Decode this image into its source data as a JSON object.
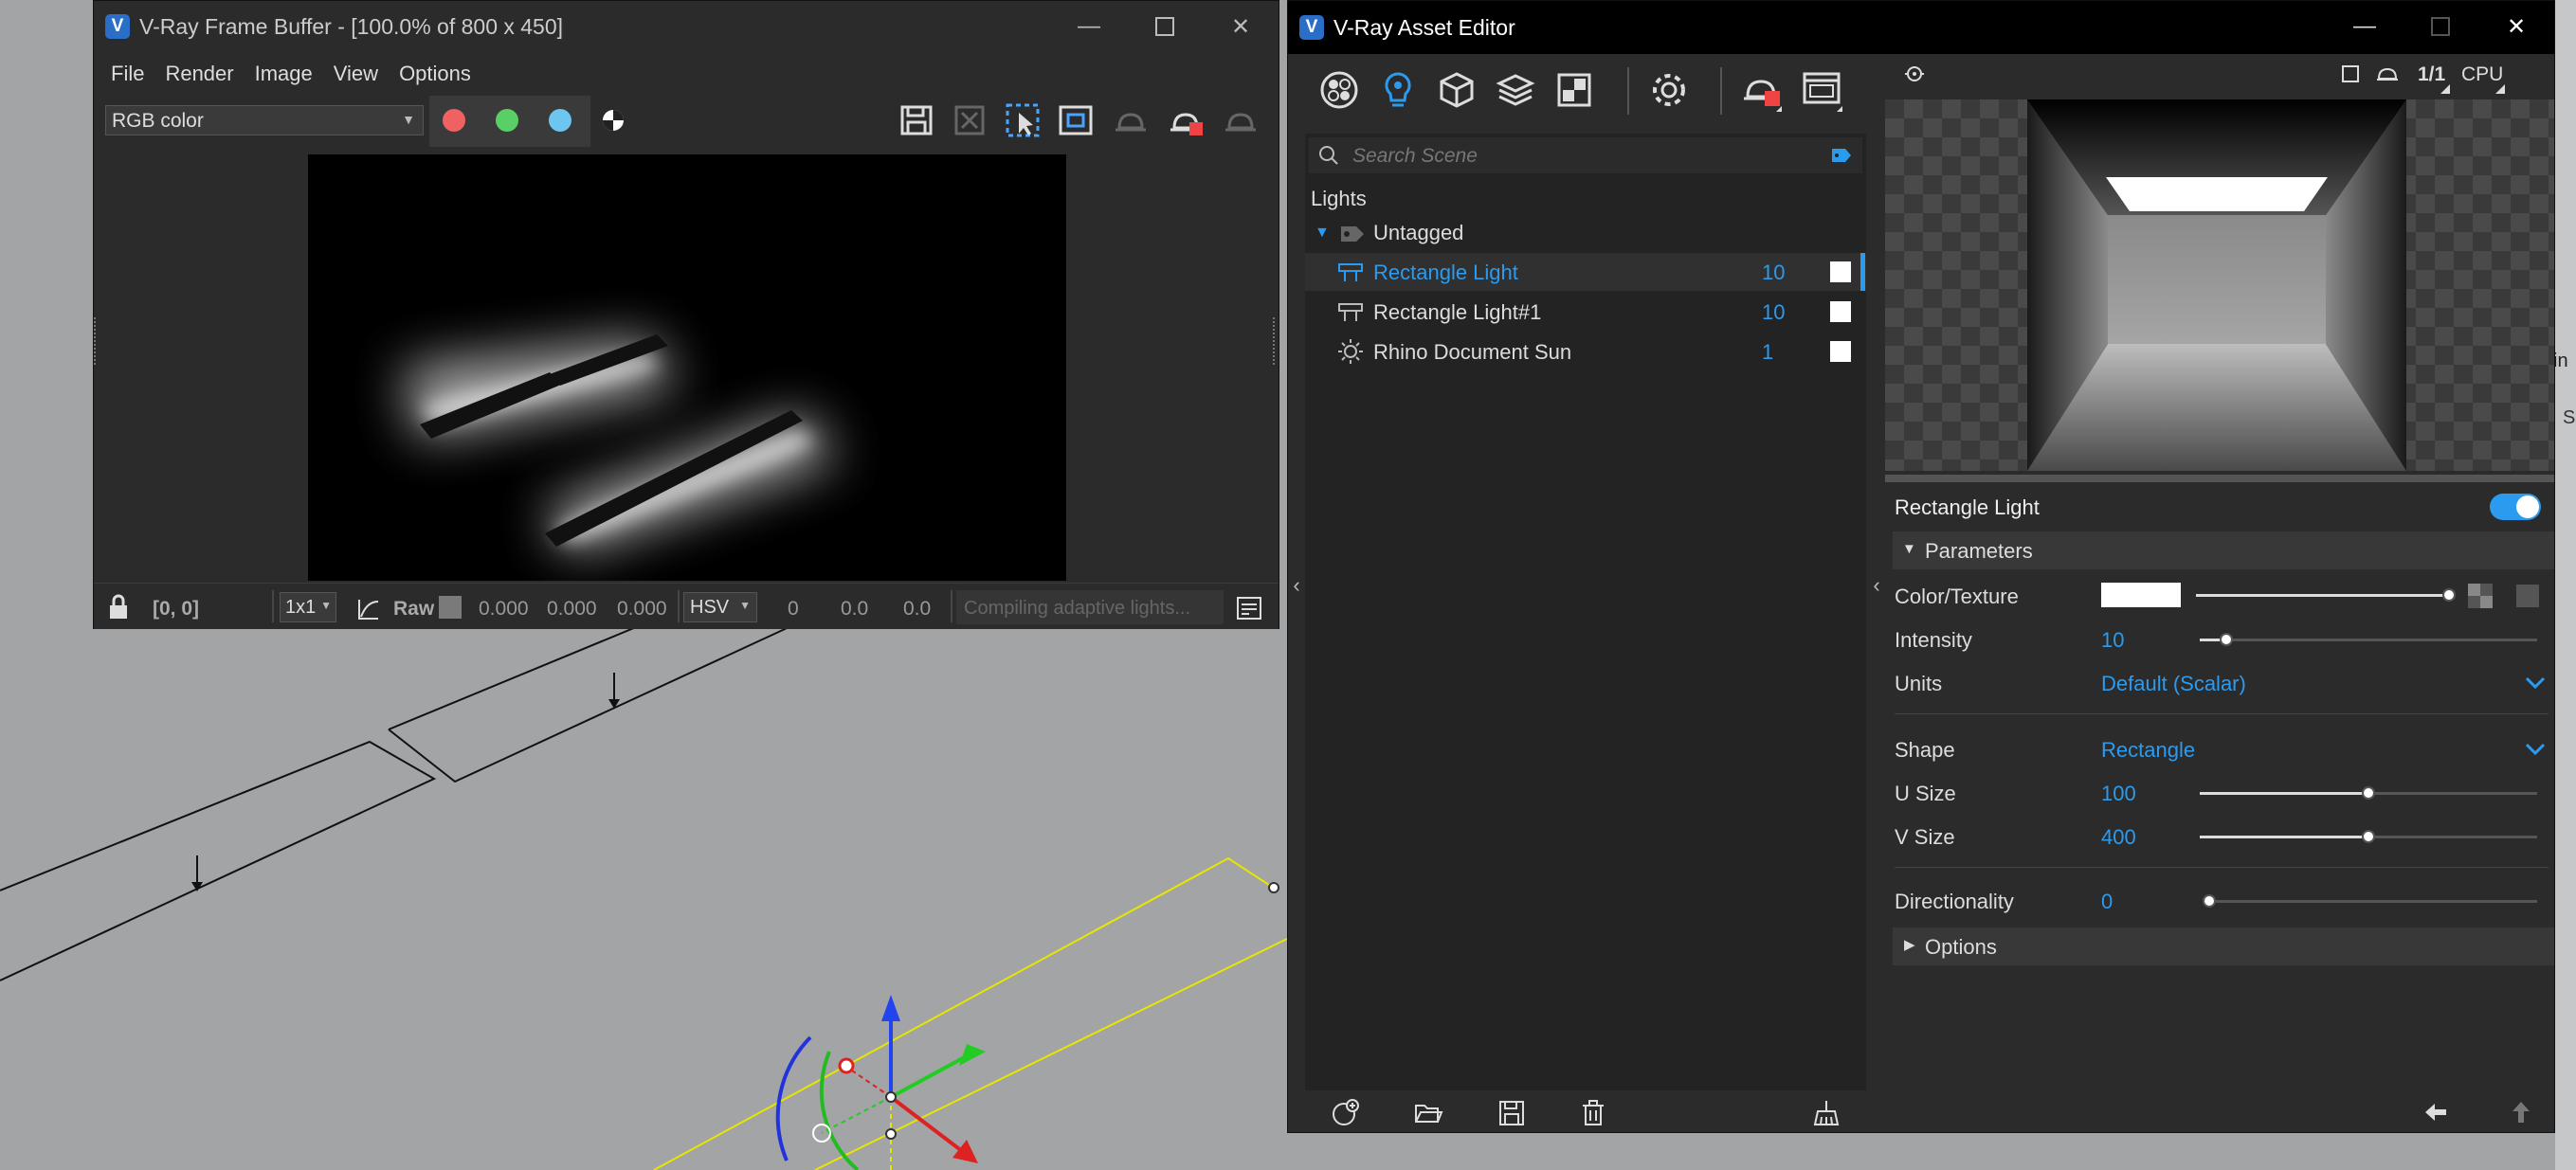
{
  "frame_buffer": {
    "title": "V-Ray Frame Buffer - [100.0% of 800 x 450]",
    "menu": [
      "File",
      "Render",
      "Image",
      "View",
      "Options"
    ],
    "channel_select": "RGB color",
    "status": {
      "coords": "[0, 0]",
      "sample": "1x1",
      "raw_label": "Raw",
      "raw_values": [
        "0.000",
        "0.000",
        "0.000"
      ],
      "color_space": "HSV",
      "hsv_values": [
        "0",
        "0.0",
        "0.0"
      ],
      "progress_text": "Compiling adaptive lights..."
    },
    "colors": {
      "red": "#f06262",
      "green": "#58d066",
      "blue": "#6cc6f0"
    }
  },
  "asset_editor": {
    "title": "V-Ray Asset Editor",
    "search_placeholder": "Search Scene",
    "section": "Lights",
    "group": "Untagged",
    "lights": [
      {
        "name": "Rectangle Light",
        "value": "10",
        "icon": "rect-light-icon",
        "selected": true
      },
      {
        "name": "Rectangle Light#1",
        "value": "10",
        "icon": "rect-light-icon",
        "selected": false
      },
      {
        "name": "Rhino Document Sun",
        "value": "1",
        "icon": "sun-icon",
        "selected": false
      }
    ],
    "preview_controls": {
      "ratio": "1/1",
      "engine": "CPU"
    },
    "properties": {
      "title": "Rectangle Light",
      "parameters_label": "Parameters",
      "color_texture_label": "Color/Texture",
      "intensity_label": "Intensity",
      "intensity_value": "10",
      "intensity_fraction": 0.08,
      "units_label": "Units",
      "units_value": "Default (Scalar)",
      "shape_label": "Shape",
      "shape_value": "Rectangle",
      "u_size_label": "U Size",
      "u_size_value": "100",
      "u_size_fraction": 0.5,
      "v_size_label": "V Size",
      "v_size_value": "400",
      "v_size_fraction": 0.5,
      "directionality_label": "Directionality",
      "directionality_value": "0",
      "directionality_fraction": 0.0,
      "options_label": "Options"
    },
    "accent": "#2b9bf0"
  },
  "right_edge": {
    "text1": "in",
    "text2": "S"
  }
}
